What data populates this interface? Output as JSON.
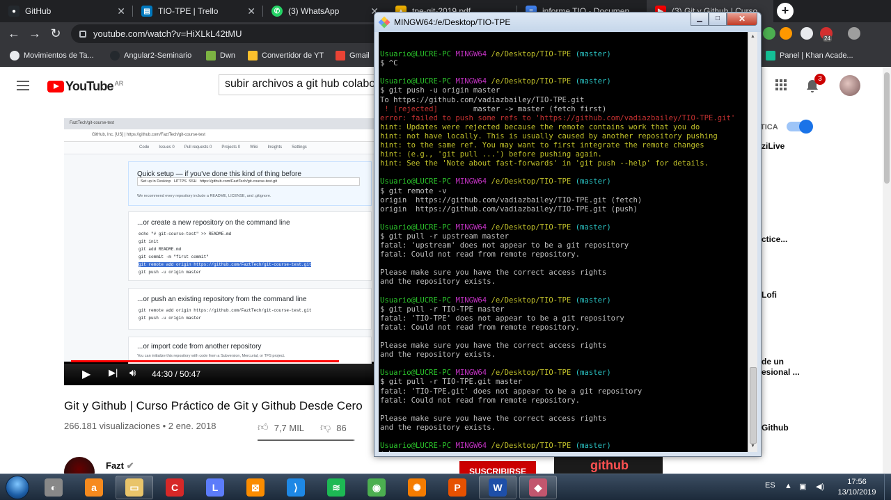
{
  "browser": {
    "tabs": [
      {
        "title": "GitHub",
        "icon": "github-icon",
        "color": "#24292e"
      },
      {
        "title": "TIO-TPE | Trello",
        "icon": "trello-icon",
        "color": "#0079bf"
      },
      {
        "title": "(3) WhatsApp",
        "icon": "whatsapp-icon",
        "color": "#25d366"
      },
      {
        "title": "tpe-git-2019.pdf",
        "icon": "drive-icon",
        "color": "#f4b400"
      },
      {
        "title": "informe TIO - Documen",
        "icon": "docs-icon",
        "color": "#4285f4"
      },
      {
        "title": "(3) Git y Github | Curso",
        "icon": "youtube-icon",
        "color": "#ff0000"
      }
    ],
    "url": "youtube.com/watch?v=HiXLkL42tMU",
    "bookmarks": [
      {
        "label": "Movimientos de Ta...",
        "color": "#e8eaed"
      },
      {
        "label": "Angular2-Seminario",
        "color": "#24292e"
      },
      {
        "label": "Dwn",
        "color": "#7cb342"
      },
      {
        "label": "Convertidor de YT",
        "color": "#fbc02d"
      },
      {
        "label": "Gmail",
        "color": "#ea4335"
      },
      {
        "label": "Panel | Khan Acade...",
        "color": "#14bf96"
      }
    ],
    "extension_badge": "24"
  },
  "youtube": {
    "logo": "YouTube",
    "country": "AR",
    "search_query": "subir archivos a git hub colabora",
    "notification_count": "3",
    "video": {
      "time": "44:30 / 50:47",
      "progress": 0.876,
      "title": "Git y Github | Curso Práctico de Git y Github Desde Cero",
      "meta": "266.181 visualizaciones • 2 ene. 2018",
      "likes": "7,7 MIL",
      "dislikes": "86",
      "like_ratio": 0.989,
      "screen": {
        "page_title": "GitHub, Inc. [US] | https://github.com/FaztTech/git-course-test",
        "tab": "FaztTech/git-course-test",
        "nav": [
          "Code",
          "Issues 0",
          "Pull requests 0",
          "Projects 0",
          "Wiki",
          "Insights",
          "Settings"
        ],
        "quick_setup": "Quick setup — if you've done this kind of thing before",
        "setup_desktop": "Set up in Desktop",
        "https": "HTTPS",
        "ssh": "SSH",
        "clone_url": "https://github.com/FaztTech/git-course-test.git",
        "recommend": "We recommend every repository include a README, LICENSE, and .gitignore.",
        "create_heading": "...or create a new repository on the command line",
        "create_cmds": [
          "echo \"# git-course-test\" >> README.md",
          "git init",
          "git add README.md",
          "git commit -m \"first commit\"",
          "git remote add origin https://github.com/FaztTech/git-course-test.git",
          "git push -u origin master"
        ],
        "push_heading": "...or push an existing repository from the command line",
        "push_cmds": [
          "git remote add origin https://github.com/FaztTech/git-course-test.git",
          "git push -u origin master"
        ],
        "import_heading": "...or import code from another repository",
        "import_text": "You can initialize this repository with code from a Subversion, Mercurial, or TFS project."
      }
    },
    "channel": {
      "name": "Fazt",
      "subscribe": "SUSCRIBIRSE"
    },
    "autoplay_label": "TICA",
    "sidebar_titles": [
      "ziLive",
      "ctice...",
      "Lofi",
      "de un",
      "esional ...",
      "Github"
    ],
    "rec_thumb_text": "github"
  },
  "terminal": {
    "title": "MINGW64:/e/Desktop/TIO-TPE",
    "colors": {
      "user": "#2bc62b",
      "host": "#c232c2",
      "path": "#c2c22b",
      "branch": "#2bc6c6",
      "error": "#c83232",
      "hint": "#c2c22b",
      "text": "#c0c0c0"
    },
    "lines": [
      {
        "type": "blank",
        "text": ""
      },
      {
        "type": "prompt",
        "user": "Usuario@LUCRE-PC",
        "host": "MINGW64",
        "path": "/e/Desktop/TIO-TPE",
        "branch": "(master)"
      },
      {
        "type": "plain",
        "text": "$ ^C"
      },
      {
        "type": "blank",
        "text": ""
      },
      {
        "type": "prompt",
        "user": "Usuario@LUCRE-PC",
        "host": "MINGW64",
        "path": "/e/Desktop/TIO-TPE",
        "branch": "(master)"
      },
      {
        "type": "plain",
        "text": "$ git push -u origin master"
      },
      {
        "type": "plain",
        "text": "To https://github.com/vadiazbailey/TIO-TPE.git"
      },
      {
        "type": "rejected",
        "text": " ! [rejected]",
        "rest": "        master -> master (fetch first)"
      },
      {
        "type": "error",
        "text": "error: failed to push some refs to 'https://github.com/vadiazbailey/TIO-TPE.git'"
      },
      {
        "type": "hint",
        "text": "hint: Updates were rejected because the remote contains work that you do"
      },
      {
        "type": "hint",
        "text": "hint: not have locally. This is usually caused by another repository pushing"
      },
      {
        "type": "hint",
        "text": "hint: to the same ref. You may want to first integrate the remote changes"
      },
      {
        "type": "hint",
        "text": "hint: (e.g., 'git pull ...') before pushing again."
      },
      {
        "type": "hint",
        "text": "hint: See the 'Note about fast-forwards' in 'git push --help' for details."
      },
      {
        "type": "blank",
        "text": ""
      },
      {
        "type": "prompt",
        "user": "Usuario@LUCRE-PC",
        "host": "MINGW64",
        "path": "/e/Desktop/TIO-TPE",
        "branch": "(master)"
      },
      {
        "type": "plain",
        "text": "$ git remote -v"
      },
      {
        "type": "plain",
        "text": "origin  https://github.com/vadiazbailey/TIO-TPE.git (fetch)"
      },
      {
        "type": "plain",
        "text": "origin  https://github.com/vadiazbailey/TIO-TPE.git (push)"
      },
      {
        "type": "blank",
        "text": ""
      },
      {
        "type": "prompt",
        "user": "Usuario@LUCRE-PC",
        "host": "MINGW64",
        "path": "/e/Desktop/TIO-TPE",
        "branch": "(master)"
      },
      {
        "type": "plain",
        "text": "$ git pull -r upstream master"
      },
      {
        "type": "plain",
        "text": "fatal: 'upstream' does not appear to be a git repository"
      },
      {
        "type": "plain",
        "text": "fatal: Could not read from remote repository."
      },
      {
        "type": "blank",
        "text": ""
      },
      {
        "type": "plain",
        "text": "Please make sure you have the correct access rights"
      },
      {
        "type": "plain",
        "text": "and the repository exists."
      },
      {
        "type": "blank",
        "text": ""
      },
      {
        "type": "prompt",
        "user": "Usuario@LUCRE-PC",
        "host": "MINGW64",
        "path": "/e/Desktop/TIO-TPE",
        "branch": "(master)"
      },
      {
        "type": "plain",
        "text": "$ git pull -r TIO-TPE master"
      },
      {
        "type": "plain",
        "text": "fatal: 'TIO-TPE' does not appear to be a git repository"
      },
      {
        "type": "plain",
        "text": "fatal: Could not read from remote repository."
      },
      {
        "type": "blank",
        "text": ""
      },
      {
        "type": "plain",
        "text": "Please make sure you have the correct access rights"
      },
      {
        "type": "plain",
        "text": "and the repository exists."
      },
      {
        "type": "blank",
        "text": ""
      },
      {
        "type": "prompt",
        "user": "Usuario@LUCRE-PC",
        "host": "MINGW64",
        "path": "/e/Desktop/TIO-TPE",
        "branch": "(master)"
      },
      {
        "type": "plain",
        "text": "$ git pull -r TIO-TPE.git master"
      },
      {
        "type": "plain",
        "text": "fatal: 'TIO-TPE.git' does not appear to be a git repository"
      },
      {
        "type": "plain",
        "text": "fatal: Could not read from remote repository."
      },
      {
        "type": "blank",
        "text": ""
      },
      {
        "type": "plain",
        "text": "Please make sure you have the correct access rights"
      },
      {
        "type": "plain",
        "text": "and the repository exists."
      },
      {
        "type": "blank",
        "text": ""
      },
      {
        "type": "prompt",
        "user": "Usuario@LUCRE-PC",
        "host": "MINGW64",
        "path": "/e/Desktop/TIO-TPE",
        "branch": "(master)"
      },
      {
        "type": "input",
        "text": "$ "
      }
    ]
  },
  "taskbar": {
    "apps": [
      {
        "name": "unknown-app-icon",
        "color": "#888888",
        "glyph": "◐"
      },
      {
        "name": "avast-icon",
        "color": "#f68a1e",
        "glyph": "a"
      },
      {
        "name": "file-explorer-icon",
        "color": "#e9c46a",
        "glyph": "▭"
      },
      {
        "name": "ccleaner-icon",
        "color": "#d62828",
        "glyph": "C"
      },
      {
        "name": "app-icon",
        "color": "#5c7cfa",
        "glyph": "L"
      },
      {
        "name": "xampp-icon",
        "color": "#fb8c00",
        "glyph": "⊠"
      },
      {
        "name": "vscode-icon",
        "color": "#1e88e5",
        "glyph": "⟩"
      },
      {
        "name": "spotify-icon",
        "color": "#1db954",
        "glyph": "≋"
      },
      {
        "name": "chrome-icon",
        "color": "#4caf50",
        "glyph": "◉"
      },
      {
        "name": "settings-icon",
        "color": "#f57c00",
        "glyph": "✺"
      },
      {
        "name": "pdf-icon",
        "color": "#e65100",
        "glyph": "P"
      },
      {
        "name": "word-icon",
        "color": "#1e4fa8",
        "glyph": "W"
      },
      {
        "name": "git-bash-icon",
        "color": "#c2566e",
        "glyph": "◆"
      }
    ],
    "language": "ES",
    "time": "17:56",
    "date": "13/10/2019"
  }
}
